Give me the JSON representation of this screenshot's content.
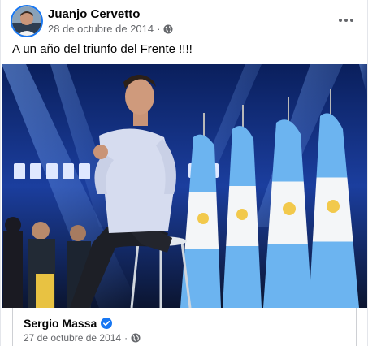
{
  "post": {
    "author": "Juanjo Cervetto",
    "date": "28 de octubre de 2014",
    "separator": "·",
    "message": "A un año del triunfo del Frente !!!!",
    "photo_icon": "photo-speaker-on-stool"
  },
  "shared": {
    "author": "Sergio Massa",
    "date": "27 de octubre de 2014",
    "separator": "·"
  },
  "icons": {
    "audience": "globe-icon",
    "menu": "more-options-icon",
    "verified": "verified-badge-icon"
  },
  "colors": {
    "accent": "#1877f2",
    "secondary_text": "#65676b",
    "primary_text": "#050505"
  }
}
